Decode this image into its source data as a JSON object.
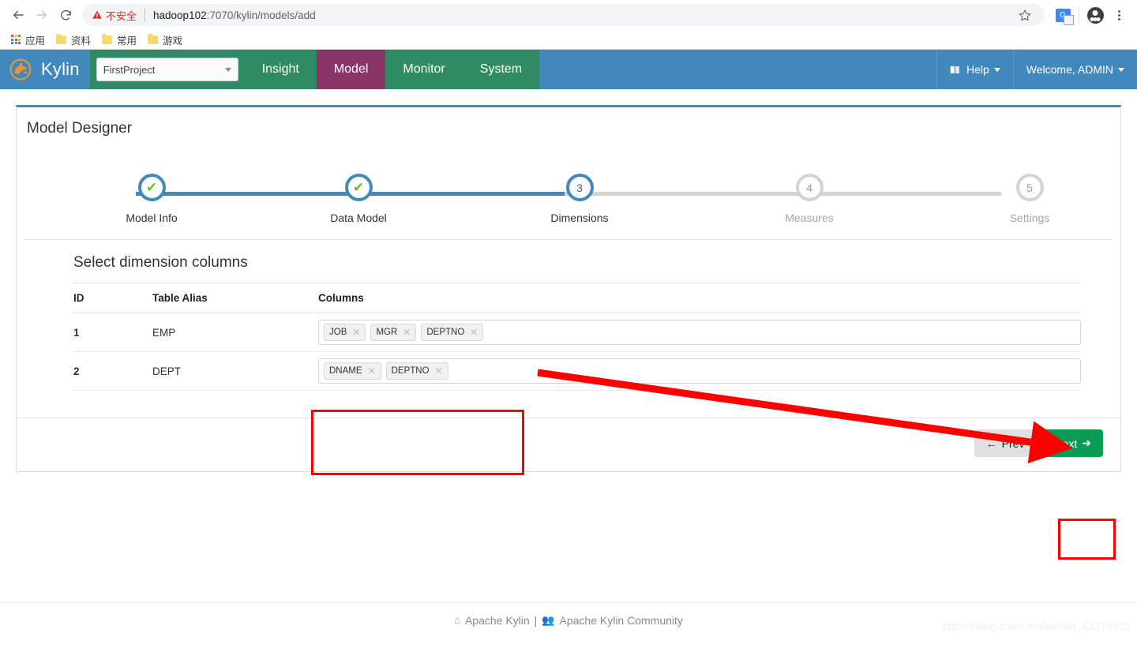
{
  "browser": {
    "back_icon": "back-arrow-icon",
    "forward_icon": "forward-arrow-icon",
    "reload_icon": "reload-icon",
    "security_warning": "不安全",
    "warning_icon": "warning-triangle-icon",
    "url_host": "hadoop102",
    "url_rest": ":7070/kylin/models/add",
    "url_full": "hadoop102:7070/kylin/models/add",
    "star_icon": "bookmark-star-icon",
    "translate_icon": "translate-icon",
    "profile_icon": "profile-avatar-icon",
    "menu_icon": "three-dot-menu-icon",
    "bookmarks": [
      {
        "label": "应用",
        "icon": "apps-grid-icon"
      },
      {
        "label": "资料",
        "icon": "folder-icon"
      },
      {
        "label": "常用",
        "icon": "folder-icon"
      },
      {
        "label": "游戏",
        "icon": "folder-icon"
      }
    ]
  },
  "navbar": {
    "brand": "Kylin",
    "brand_logo_icon": "kylin-qilin-logo-icon",
    "project_selected": "FirstProject",
    "project_caret_icon": "caret-down-icon",
    "tabs": [
      {
        "label": "Insight",
        "active": false
      },
      {
        "label": "Model",
        "active": true
      },
      {
        "label": "Monitor",
        "active": false
      },
      {
        "label": "System",
        "active": false
      }
    ],
    "help_label": "Help",
    "help_icon": "book-icon",
    "welcome_label": "Welcome, ADMIN",
    "caret_icon": "caret-down-icon"
  },
  "panel": {
    "title": "Model Designer",
    "accent_color": "#4189bd"
  },
  "stepper": {
    "steps": [
      {
        "num": "1",
        "label": "Model Info",
        "state": "done",
        "mark": "✔"
      },
      {
        "num": "2",
        "label": "Data Model",
        "state": "done",
        "mark": "✔"
      },
      {
        "num": "3",
        "label": "Dimensions",
        "state": "current",
        "mark": "3"
      },
      {
        "num": "4",
        "label": "Measures",
        "state": "upcoming",
        "mark": "4"
      },
      {
        "num": "5",
        "label": "Settings",
        "state": "upcoming",
        "mark": "5"
      }
    ],
    "progress_percent": 50
  },
  "dimensions": {
    "heading": "Select dimension columns",
    "columns": [
      "ID",
      "Table Alias",
      "Columns"
    ],
    "rows": [
      {
        "id": "1",
        "alias": "EMP",
        "tags": [
          "JOB",
          "MGR",
          "DEPTNO"
        ]
      },
      {
        "id": "2",
        "alias": "DEPT",
        "tags": [
          "DNAME",
          "DEPTNO"
        ]
      }
    ],
    "tag_remove_icon": "close-x-icon"
  },
  "actions": {
    "prev_label": "Prev",
    "prev_icon": "arrow-left-icon",
    "next_label": "Next",
    "next_icon": "arrow-right-icon",
    "next_color": "#0a9b55"
  },
  "annotations": {
    "highlight_color": "#fe0000",
    "arrow": "red-pointer-arrow"
  },
  "footer": {
    "home_icon": "home-icon",
    "link1": "Apache Kylin",
    "separator": "|",
    "community_icon": "users-icon",
    "link2": "Apache Kylin Community",
    "watermark": "https://blog.csdn.net/weixin_43270493"
  }
}
